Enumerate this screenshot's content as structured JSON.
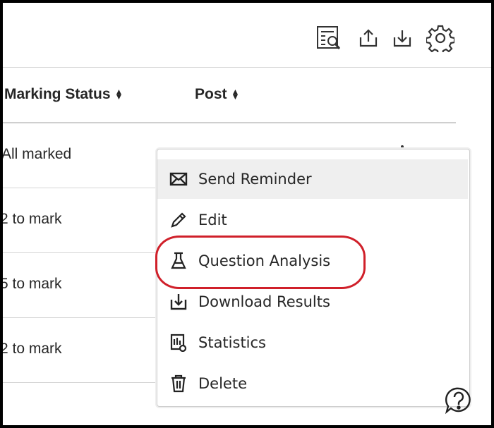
{
  "table": {
    "columns": [
      {
        "label": "Marking Status"
      },
      {
        "label": "Post"
      }
    ],
    "rows": [
      {
        "status": "All marked"
      },
      {
        "status": "2 to mark"
      },
      {
        "status": "5 to mark"
      },
      {
        "status": "2 to mark"
      }
    ]
  },
  "menu": {
    "items": [
      {
        "label": "Send Reminder",
        "icon": "envelope-icon"
      },
      {
        "label": "Edit",
        "icon": "pencil-icon"
      },
      {
        "label": "Question Analysis",
        "icon": "flask-icon"
      },
      {
        "label": "Download Results",
        "icon": "download-icon"
      },
      {
        "label": "Statistics",
        "icon": "statistics-icon"
      },
      {
        "label": "Delete",
        "icon": "trash-icon"
      }
    ]
  },
  "toolbar": {
    "icons": [
      "search-document-icon",
      "upload-icon",
      "download-icon",
      "gear-icon"
    ]
  },
  "colors": {
    "text": "#262626",
    "highlight": "#d0202a",
    "hover": "#efefef"
  }
}
